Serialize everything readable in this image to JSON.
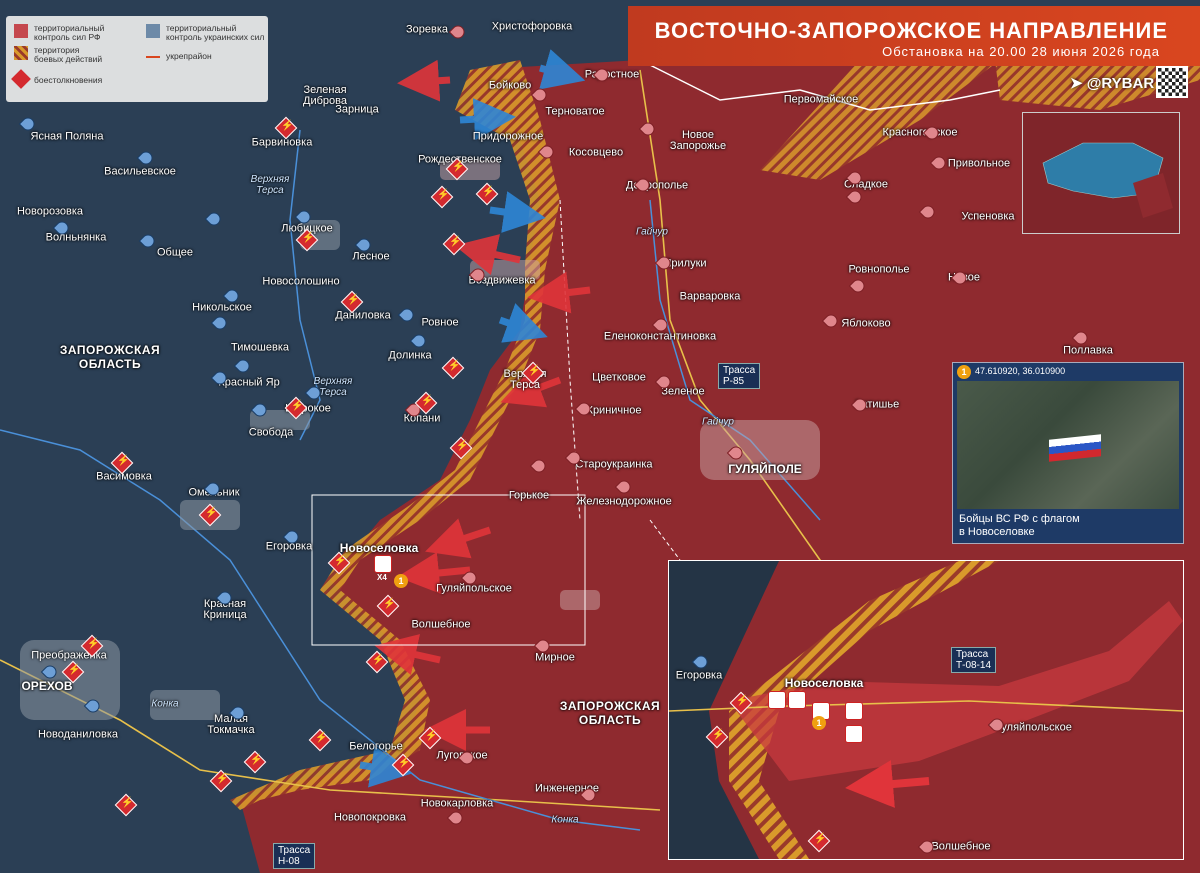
{
  "title": {
    "main": "ВОСТОЧНО-ЗАПОРОЖСКОЕ НАПРАВЛЕНИЕ",
    "subtitle": "Обстановка на 20.00 28 июня 2026 года"
  },
  "brand": "@RYBAR",
  "legend": {
    "ru_control": "территориальный\nконтроль сил РФ",
    "combat": "территория\nбоевых действий",
    "clashes": "боестолкновения",
    "ua_control": "территориальный\nконтроль украинских сил",
    "fortline": "укрепрайон"
  },
  "colors": {
    "ru": "#8f2a2f",
    "ua": "#2b3f55",
    "combat": "#d99a2b",
    "accent": "#d9461f"
  },
  "regions": [
    {
      "text": "ЗАПОРОЖСКАЯ\nОБЛАСТЬ",
      "key": "west"
    },
    {
      "text": "ЗАПОРОЖСКАЯ\nОБЛАСТЬ",
      "key": "east"
    }
  ],
  "rivers": [
    "Верхняя\nТерса",
    "Верхняя\nТерса",
    "Гайчур",
    "Гайчур",
    "Конка",
    "Конка"
  ],
  "roads": [
    "Трасса\nР-85",
    "Трасса\nН-08",
    "Трасса\nТ-08-14"
  ],
  "places": [
    "Зоревка",
    "Христофоровка",
    "Зеленая\nДиброва",
    "Зарница",
    "Бойково",
    "Радостное",
    "Терноватое",
    "Первомайское",
    "Ясная Поляна",
    "Барвиновка",
    "Придорожное",
    "Новое\nЗапорожье",
    "Красногорское",
    "Рождественское",
    "Косовцево",
    "Привольное",
    "Васильевское",
    "Сладкое",
    "Доброполье",
    "Новорозовка",
    "Успеновка",
    "Волньнянка",
    "Любицкое",
    "Общее",
    "Лесное",
    "Прилуки",
    "Ровнополье",
    "Воздвижевка",
    "Новосолошино",
    "Новое",
    "Варваровка",
    "Никольское",
    "Даниловка",
    "Яблоково",
    "Ровное",
    "Еленоконстантиновка",
    "Тимошевка",
    "Долинка",
    "Верхняя\nТерса",
    "Поллавка",
    "Красный Яр",
    "Цветковое",
    "Широкое",
    "Свобода",
    "Копани",
    "Криничное",
    "Зеленое",
    "Затишье",
    "Васимовка",
    "Горькое",
    "Староукраинка",
    "ГУЛЯЙПОЛЕ",
    "Омельник",
    "Железнодорожное",
    "Новоселовка",
    "Егоровка",
    "Гуляйпольское",
    "Красная\nКриница",
    "Волшебное",
    "Мирное",
    "Преображенка",
    "ОРЕХОВ",
    "Малая\nТокмачка",
    "Новоданиловка",
    "Белогорье",
    "Луговское",
    "Инженерное",
    "Новокарловка",
    "Новопокровка"
  ],
  "photo": {
    "coords": "47.610920, 36.010900",
    "caption": "Бойцы ВС РФ с флагом\nв Новоселовке",
    "marker": "1"
  },
  "zoom": {
    "places": [
      "Егоровка",
      "Новоселовка",
      "Гуляйпольское",
      "Волшебное"
    ],
    "marker": "1"
  },
  "counts": {
    "x4": "X4"
  },
  "icons": [
    "clash-icon",
    "ru-settlement-icon",
    "ua-settlement-icon",
    "attack-arrow-icon",
    "telegram-icon",
    "qr-code-icon",
    "flag-icon"
  ]
}
